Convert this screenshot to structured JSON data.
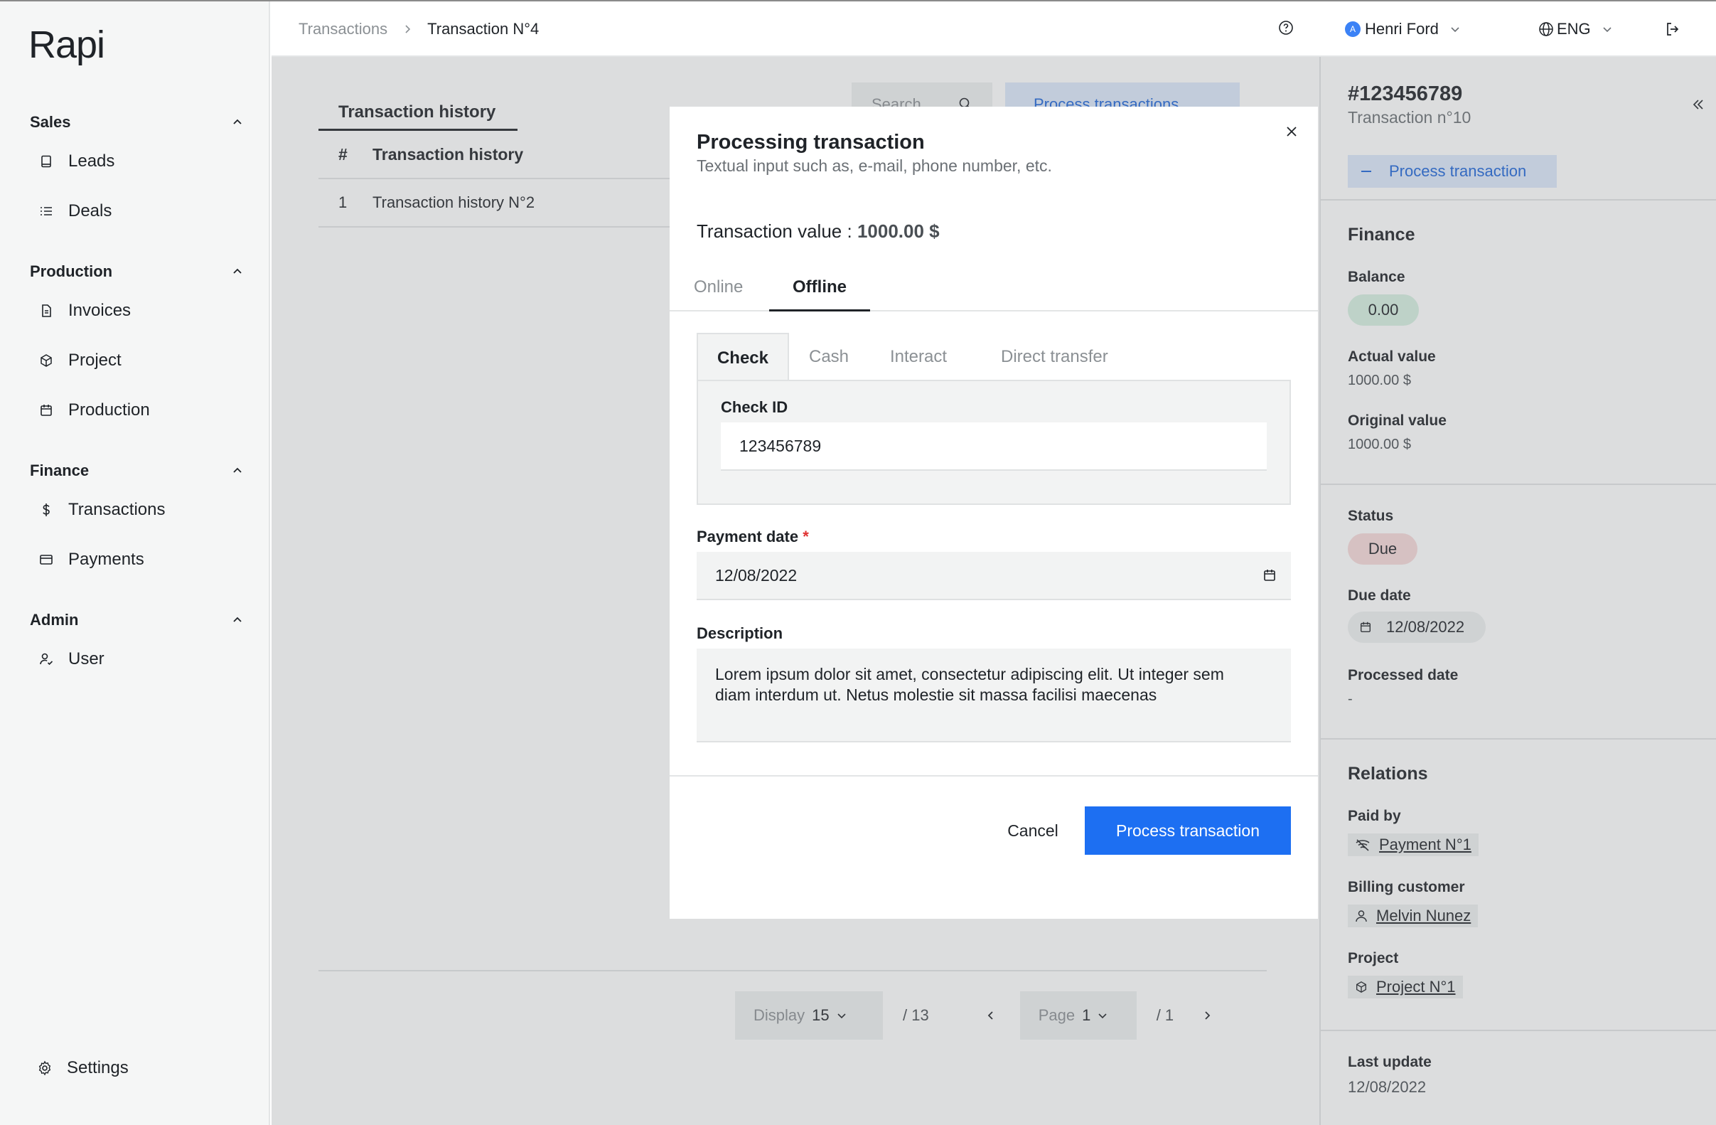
{
  "app": {
    "logo": "Rapi"
  },
  "sidebar": {
    "groups": [
      {
        "title": "Sales",
        "items": [
          {
            "label": "Leads",
            "icon": "book-icon"
          },
          {
            "label": "Deals",
            "icon": "list-icon"
          }
        ]
      },
      {
        "title": "Production",
        "items": [
          {
            "label": "Invoices",
            "icon": "document-icon"
          },
          {
            "label": "Project",
            "icon": "cube-icon"
          },
          {
            "label": "Production",
            "icon": "calendar-icon"
          }
        ]
      },
      {
        "title": "Finance",
        "items": [
          {
            "label": "Transactions",
            "icon": "dollar-icon"
          },
          {
            "label": "Payments",
            "icon": "card-icon"
          }
        ]
      },
      {
        "title": "Admin",
        "items": [
          {
            "label": "User",
            "icon": "user-check-icon"
          }
        ]
      }
    ],
    "settings_label": "Settings"
  },
  "topbar": {
    "breadcrumb": [
      "Transactions",
      "Transaction N°4"
    ],
    "user_initial": "A",
    "user_name": "Henri Ford",
    "language": "ENG"
  },
  "main": {
    "tab_label": "Transaction history",
    "search_placeholder": "Search",
    "process_button": "Process transactions",
    "table": {
      "headers": [
        "#",
        "Transaction history"
      ],
      "rows": [
        [
          "1",
          "Transaction history N°2"
        ]
      ]
    },
    "pager": {
      "display_label": "Display",
      "display_value": "15",
      "total_items": "/ 13",
      "page_label": "Page",
      "page_value": "1",
      "total_pages": "/ 1"
    }
  },
  "right_panel": {
    "id": "#123456789",
    "subtitle": "Transaction  n°10",
    "process_button": "Process transaction",
    "finance": {
      "title": "Finance",
      "balance_label": "Balance",
      "balance_value": "0.00",
      "actual_label": "Actual value",
      "actual_value": "1000.00 $",
      "original_label": "Original value",
      "original_value": "1000.00 $"
    },
    "status": {
      "status_label": "Status",
      "status_value": "Due",
      "due_label": "Due date",
      "due_value": "12/08/2022",
      "processed_label": "Processed date",
      "processed_value": "-"
    },
    "relations": {
      "title": "Relations",
      "paid_label": "Paid by",
      "paid_value": "Payment N°1",
      "customer_label": "Billing customer",
      "customer_value": "Melvin Nunez",
      "project_label": "Project",
      "project_value": "Project N°1"
    },
    "last_update_label": "Last update",
    "last_update_value": "12/08/2022"
  },
  "modal": {
    "title": "Processing transaction",
    "subtitle": "Textual input such as, e-mail, phone number, etc.",
    "value_label": "Transaction value : ",
    "value_amount": "1000.00 $",
    "tabs": [
      "Online",
      "Offline"
    ],
    "subtabs": [
      "Check",
      "Cash",
      "Interact",
      "Direct transfer"
    ],
    "check_id_label": "Check ID",
    "check_id_value": "123456789",
    "payment_date_label": "Payment date",
    "payment_date_required": "*",
    "payment_date_value": "12/08/2022",
    "description_label": "Description",
    "description_value": "Lorem ipsum dolor sit amet, consectetur adipiscing elit. Ut integer sem diam interdum ut. Netus molestie sit massa facilisi maecenas",
    "cancel_label": "Cancel",
    "submit_label": "Process transaction"
  },
  "colors": {
    "primary": "#1d6ff2",
    "primary_light": "#dce8fb",
    "balance_pill": "#d7f0e2",
    "due_pill": "#f7dada"
  }
}
